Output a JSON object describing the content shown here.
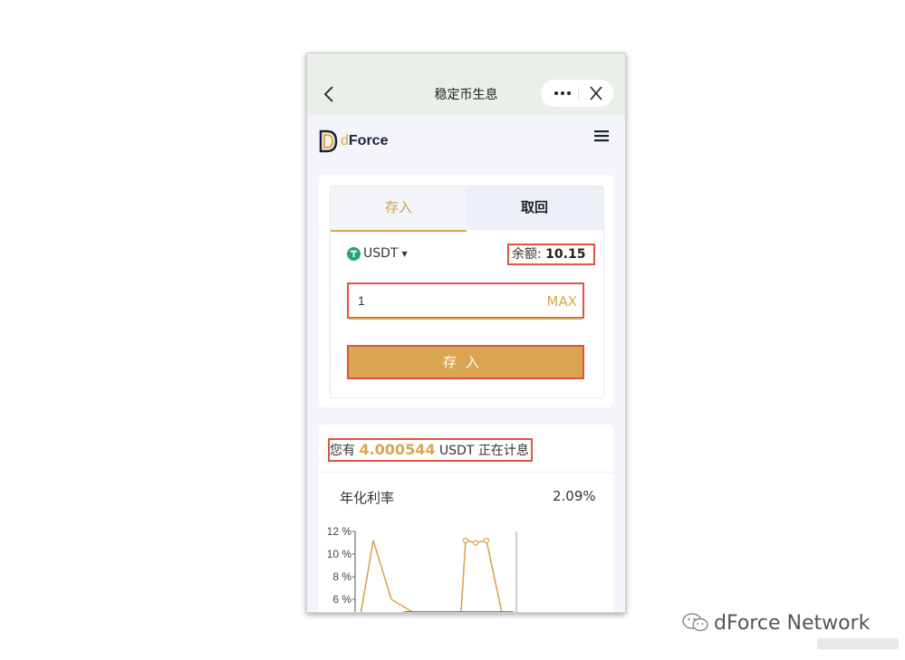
{
  "nav": {
    "title": "稳定币生息"
  },
  "header": {
    "brand_prefix": "d",
    "brand_rest": "Force"
  },
  "deposit_card": {
    "tabs": [
      {
        "label": "存入"
      },
      {
        "label": "取回"
      }
    ],
    "token": "USDT",
    "balance_label": "余额:",
    "balance_value": "10.15",
    "amount_value": "1",
    "max_label": "MAX",
    "submit_label": "存入"
  },
  "earning_card": {
    "prefix": "您有",
    "amount": "4.000544",
    "suffix": "USDT 正在计息",
    "apr_label": "年化利率",
    "apr_value": "2.09%"
  },
  "chart_data": {
    "type": "line",
    "yticks": [
      "12 %",
      "10 %",
      "8 %",
      "6 %"
    ],
    "series": [
      {
        "values": [
          0.6,
          11.2,
          6.0,
          0.5,
          0.5,
          11.2,
          11.0,
          11.2,
          0.6
        ]
      }
    ]
  },
  "colors": {
    "accent": "#d9a550",
    "highlight_box": "#e05440",
    "tether": "#26a17b"
  },
  "footer": {
    "brand": "dForce Network"
  }
}
